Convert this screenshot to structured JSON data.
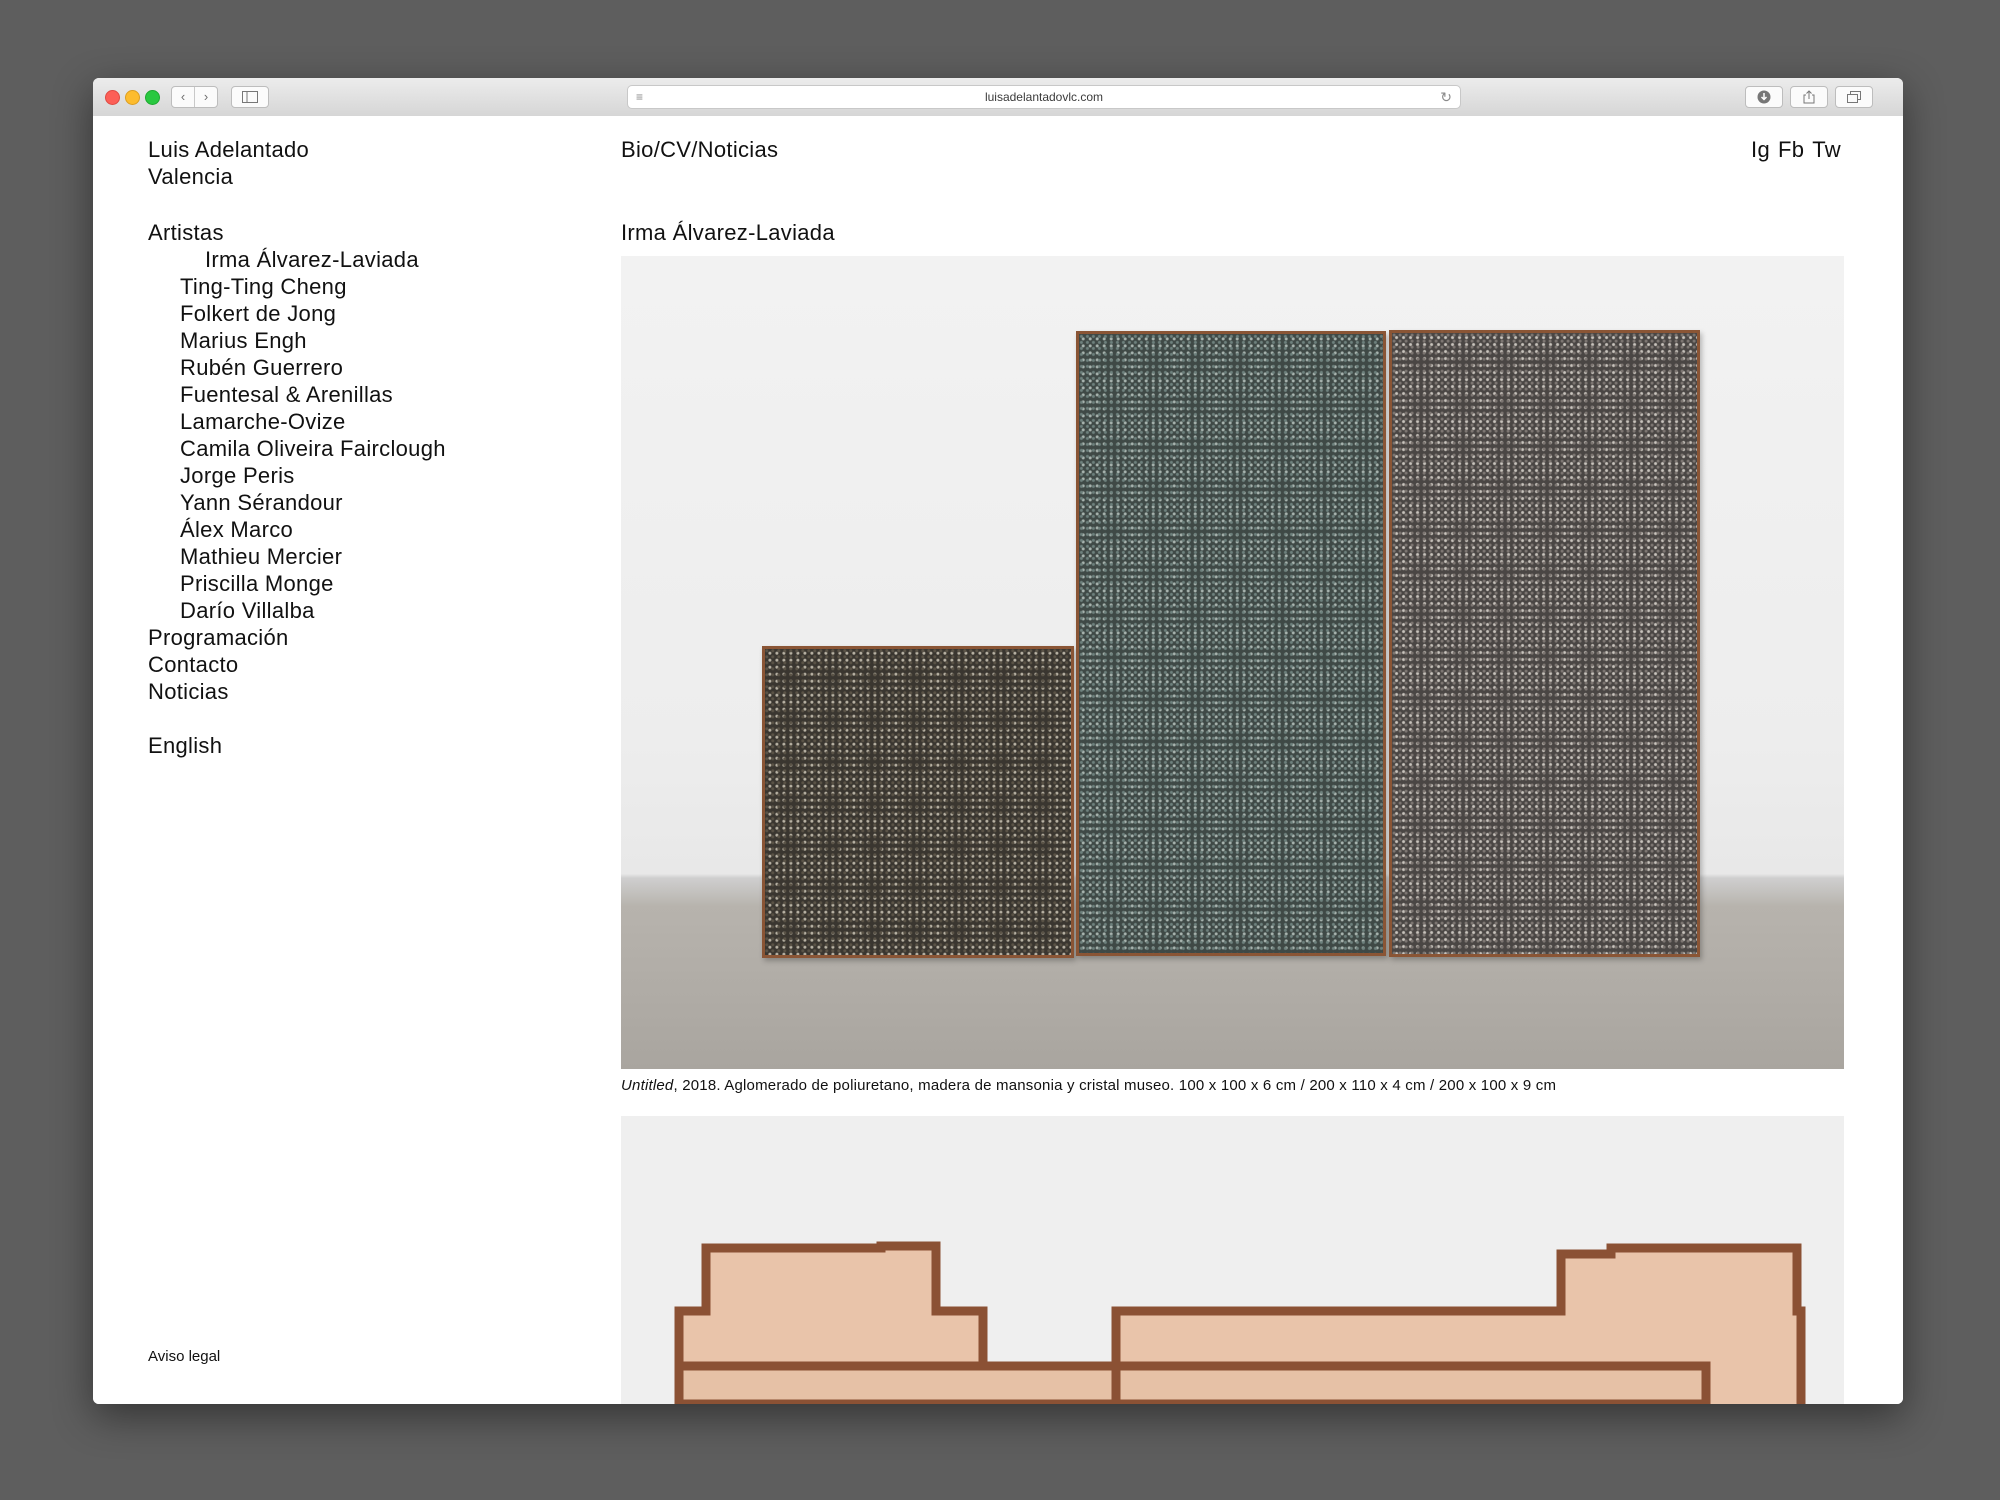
{
  "browser": {
    "url": "luisadelantadovlc.com"
  },
  "header": {
    "gallery_name": "Luis Adelantado",
    "city": "Valencia",
    "bio_link": "Bio/CV/Noticias",
    "social": [
      "Ig",
      "Fb",
      "Tw"
    ]
  },
  "sidebar": {
    "artists_label": "Artistas",
    "artists": [
      "Irma Álvarez-Laviada",
      "Ting-Ting Cheng",
      "Folkert de Jong",
      "Marius Engh",
      "Rubén Guerrero",
      "Fuentesal & Arenillas",
      "Lamarche-Ovize",
      "Camila Oliveira Fairclough",
      "Jorge Peris",
      "Yann Sérandour",
      "Álex Marco",
      "Mathieu Mercier",
      "Priscilla Monge",
      "Darío Villalba"
    ],
    "programacion": "Programación",
    "contacto": "Contacto",
    "noticias": "Noticias",
    "language": "English",
    "legal": "Aviso legal"
  },
  "main": {
    "artist_title": "Irma Álvarez-Laviada",
    "works": [
      {
        "title": "Untitled",
        "caption": ", 2018. Aglomerado de poliuretano, madera de mansonia y cristal museo. 100 x 100 x 6 cm / 200 x 110 x 4 cm / 200 x 100 x 9 cm"
      }
    ]
  }
}
